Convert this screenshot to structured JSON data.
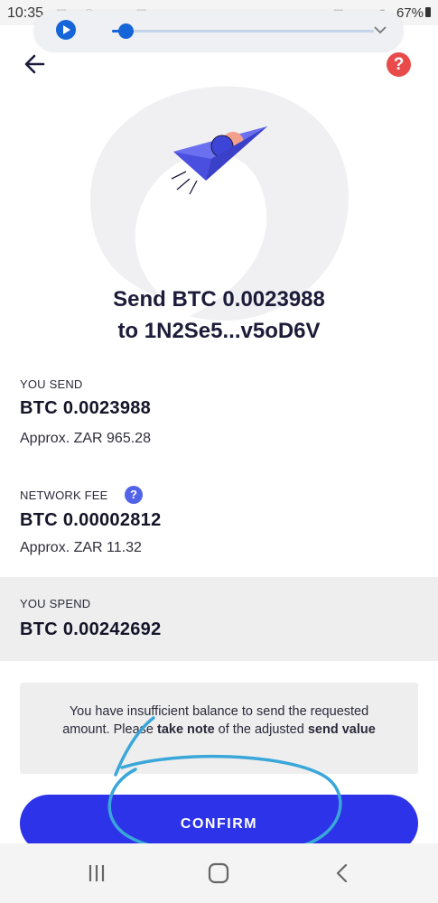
{
  "status": {
    "time": "10:35",
    "battery": "67%"
  },
  "header": {
    "help_label": "?"
  },
  "summary": {
    "title_line1": "Send BTC 0.0023988",
    "title_line2": "to 1N2Se5...v5oD6V"
  },
  "you_send": {
    "label": "YOU SEND",
    "value": "BTC 0.0023988",
    "approx": "Approx. ZAR 965.28"
  },
  "network_fee": {
    "label": "NETWORK FEE",
    "info": "?",
    "value": "BTC 0.00002812",
    "approx": "Approx. ZAR 11.32"
  },
  "you_spend": {
    "label": "YOU SPEND",
    "value": "BTC 0.00242692"
  },
  "warning": {
    "part1": "You have insufficient balance to send the requested amount. Please ",
    "bold1": "take note",
    "part2": " of the adjusted ",
    "bold2": "send value"
  },
  "confirm_label": "CONFIRM",
  "media": {
    "progress": 0.05
  },
  "colors": {
    "accent": "#2c33e8",
    "help": "#e94b4b",
    "info": "#5263e8",
    "media": "#1565d8",
    "scribble": "#3aa7d9"
  },
  "icons": [
    "back-arrow-icon",
    "help-icon",
    "play-icon",
    "chevron-down-icon",
    "paper-plane-icon",
    "info-icon",
    "recent-apps-icon",
    "home-icon",
    "back-icon"
  ]
}
